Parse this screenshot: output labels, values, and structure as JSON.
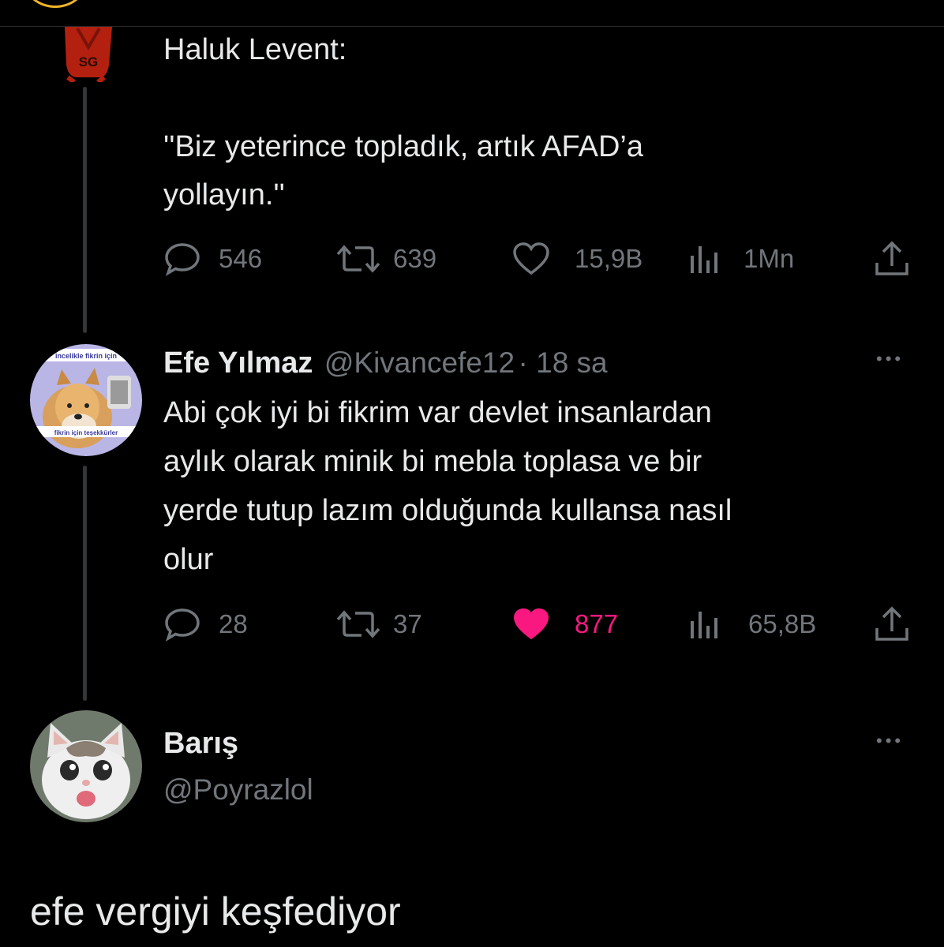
{
  "quoted": {
    "avatar_text": "SG",
    "intro": "Haluk Levent:",
    "quote_line1": "''Biz yeterince topladık, artık AFAD’a",
    "quote_line2": "yollayın.''",
    "icons": [
      "comment-icon",
      "retweet-icon",
      "heart-icon",
      "views-icon",
      "share-icon"
    ],
    "stats": {
      "comments": "546",
      "retweets": "639",
      "likes": "15,9B",
      "views": "1Mn"
    }
  },
  "reply": {
    "name": "Efe Yılmaz",
    "handle": "@Kivancefe12",
    "time": "· 18 sa",
    "more": "•••",
    "avatar_top_text": "incelikle fikrin için",
    "avatar_bottom_text": "fikrin için teşekkürler",
    "lines": [
      "Abi çok iyi bi fikrim var devlet insanlardan",
      "aylık olarak minik bi mebla toplasa ve bir",
      "yerde tutup lazım olduğunda kullansa nasıl",
      "olur"
    ],
    "stats": {
      "comments": "28",
      "retweets": "37",
      "likes": "877",
      "views": "65,8B"
    },
    "liked": true
  },
  "main_tweet": {
    "name": "Barış",
    "handle": "@Poyrazlol",
    "more": "•••",
    "text": "efe vergiyi keşfediyor"
  },
  "colors": {
    "background": "#000000",
    "text": "#e7e9ea",
    "muted": "#71767b",
    "like": "#f91880",
    "thread_line": "#333639"
  }
}
